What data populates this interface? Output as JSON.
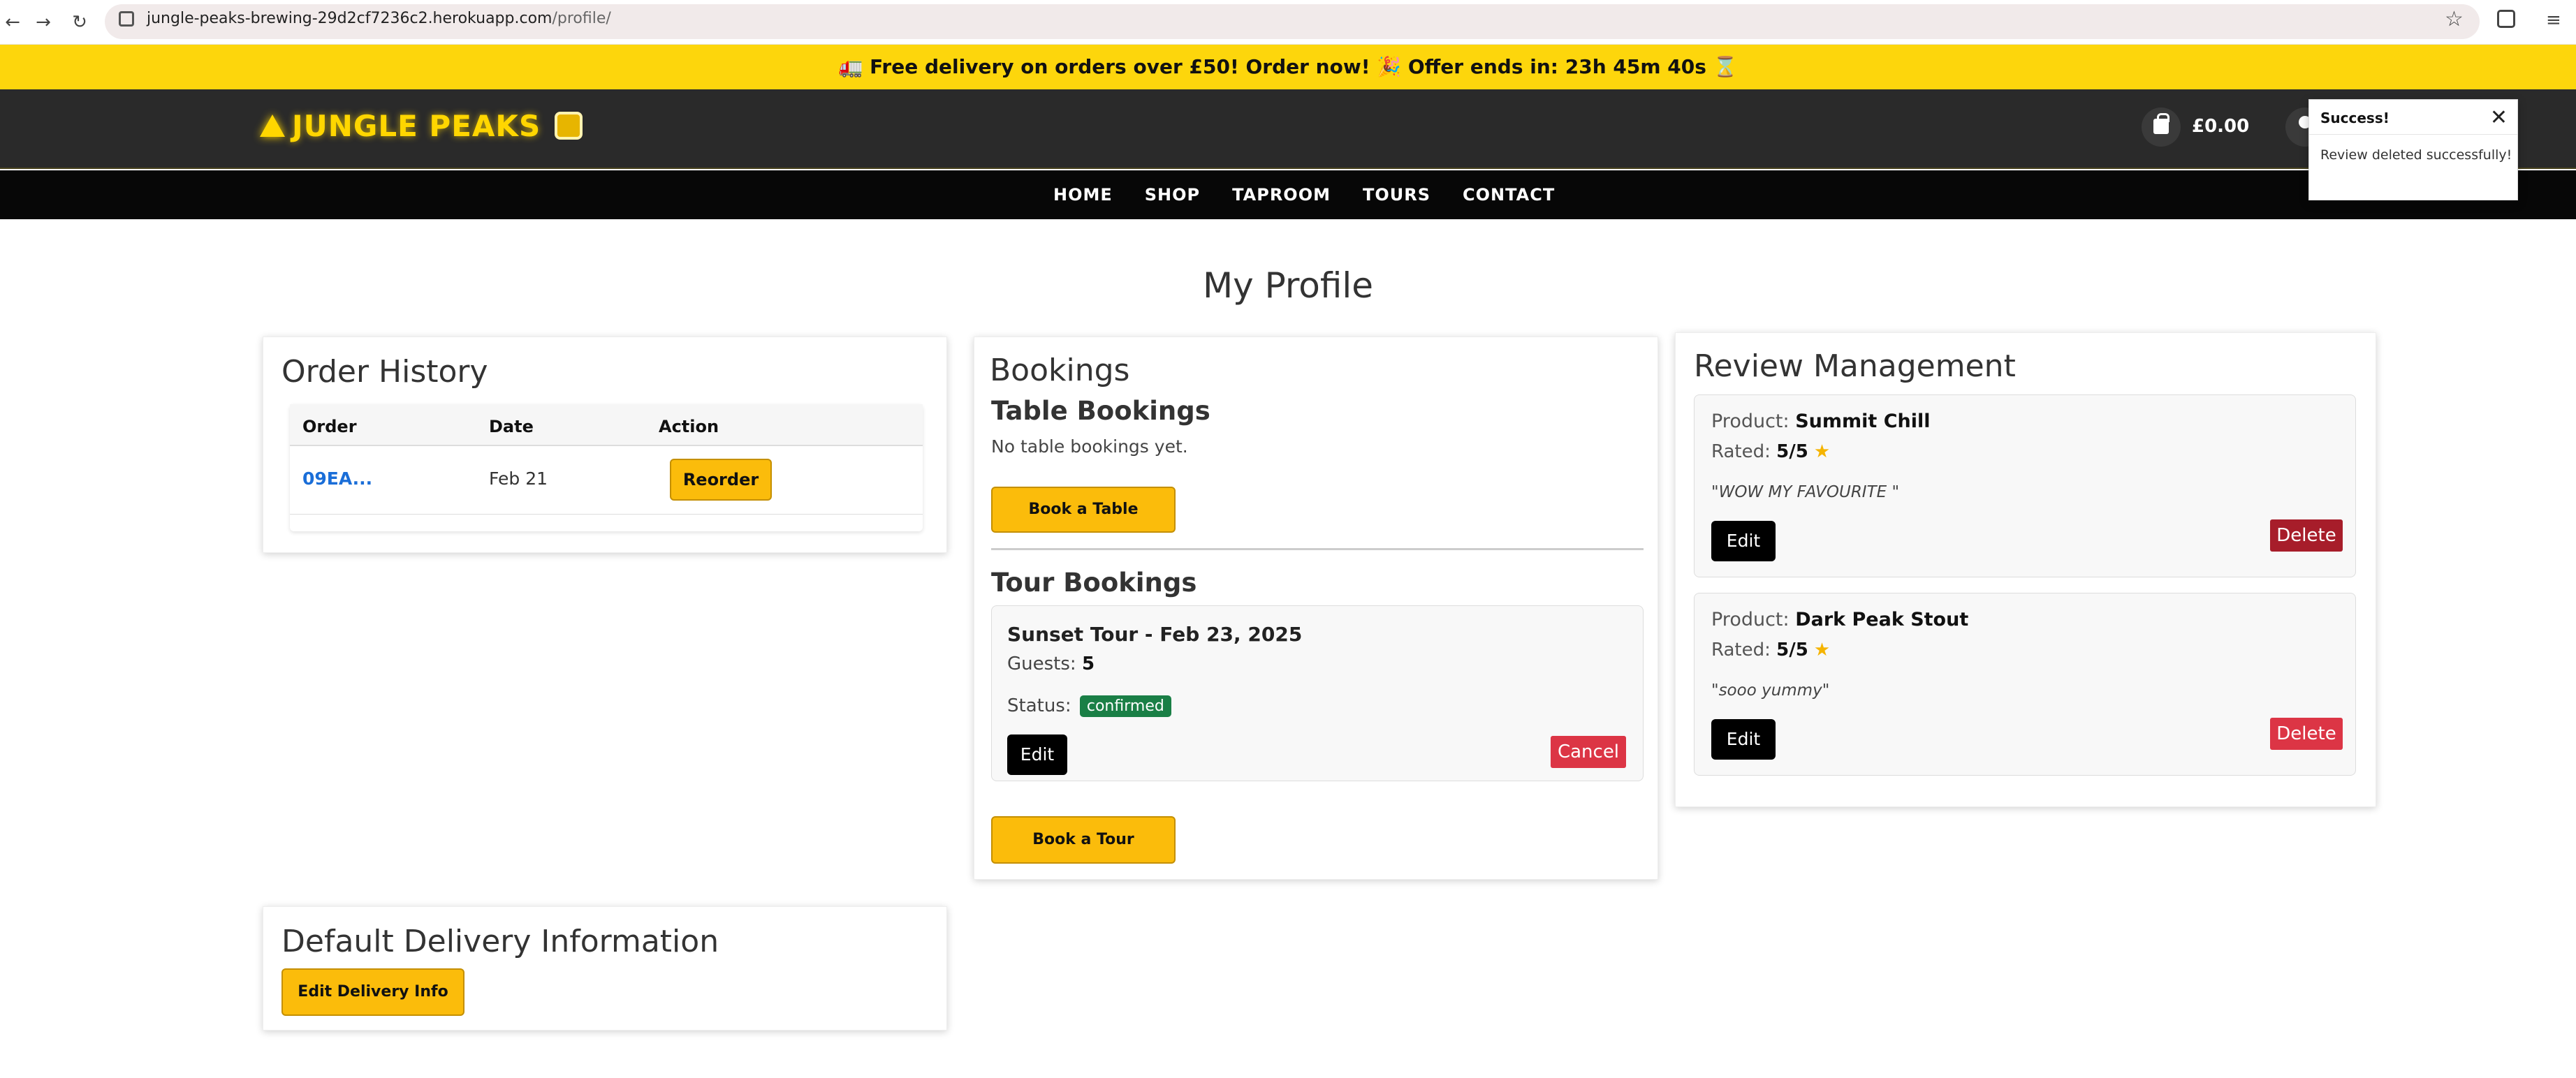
{
  "browser": {
    "url_host": "jungle-peaks-brewing-29d2cf7236c2.herokuapp.com",
    "url_path": "/profile/"
  },
  "promo": {
    "text": "🚛 Free delivery on orders over £50! Order now! 🎉 Offer ends in: 23h 45m 40s ⌛"
  },
  "header": {
    "logo_text": "JUNGLE PEAKS",
    "cart_total": "£0.00"
  },
  "nav": [
    "HOME",
    "SHOP",
    "TAPROOM",
    "TOURS",
    "CONTACT"
  ],
  "toast": {
    "title": "Success!",
    "message": "Review deleted successfully!"
  },
  "page_title": "My Profile",
  "orders": {
    "title": "Order History",
    "columns": [
      "Order",
      "Date",
      "Action"
    ],
    "rows": [
      {
        "order": "09EA...",
        "date": "Feb 21",
        "action": "Reorder"
      }
    ]
  },
  "bookings": {
    "title": "Bookings",
    "table_title": "Table Bookings",
    "no_table": "No table bookings yet.",
    "book_table": "Book a Table",
    "tour_title": "Tour Bookings",
    "tour": {
      "name": "Sunset Tour - Feb 23, 2025",
      "guests_label": "Guests:",
      "guests": "5",
      "status_label": "Status:",
      "status": "confirmed",
      "edit": "Edit",
      "cancel": "Cancel"
    },
    "book_tour": "Book a Tour"
  },
  "reviews": {
    "title": "Review Management",
    "product_label": "Product:",
    "rated_label": "Rated:",
    "items": [
      {
        "product": "Summit Chill",
        "rating": "5/5",
        "text": "\"WOW MY FAVOURITE \"",
        "edit": "Edit",
        "delete": "Delete"
      },
      {
        "product": "Dark Peak Stout",
        "rating": "5/5",
        "text": "\"sooo yummy\"",
        "edit": "Edit",
        "delete": "Delete"
      }
    ]
  },
  "delivery": {
    "title": "Default Delivery Information",
    "button": "Edit Delivery Info"
  },
  "colors": {
    "accent_yellow": "#fdd60c",
    "button_yellow": "#fbbc0b",
    "danger_red": "#dc3545",
    "success_green": "#1a7f46",
    "link_blue": "#1a6ed8"
  }
}
